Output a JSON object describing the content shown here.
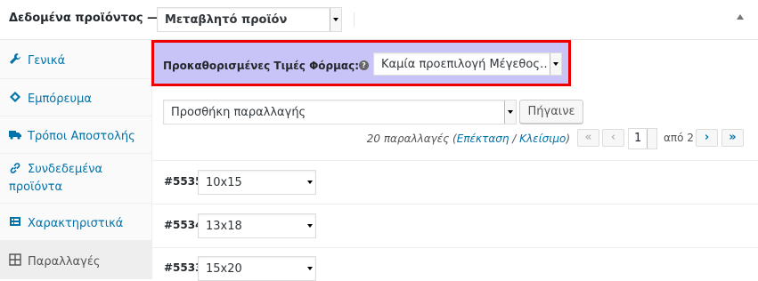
{
  "header": {
    "title": "Δεδομένα προϊόντος —",
    "product_type": "Μεταβλητό προϊόν"
  },
  "sidebar": {
    "items": [
      {
        "label": "Γενικά",
        "icon": "wrench-icon"
      },
      {
        "label": "Εμπόρευμα",
        "icon": "tag-icon"
      },
      {
        "label": "Τρόποι Αποστολής",
        "icon": "truck-icon"
      },
      {
        "label_line1": "Συνδεδεμένα",
        "label_line2": "προϊόντα",
        "icon": "link-icon"
      },
      {
        "label": "Χαρακτηριστικά",
        "icon": "list-icon"
      },
      {
        "label": "Παραλλαγές",
        "icon": "grid-icon"
      }
    ]
  },
  "defaults": {
    "label": "Προκαθορισμένες Τιμές Φόρμας:",
    "help": "?",
    "value": "Καμία προεπιλογή Μέγεθος…"
  },
  "toolbar": {
    "action": "Προσθήκη παραλλαγής",
    "go": "Πήγαινε",
    "count_prefix": "20 παραλλαγές (",
    "expand": "Επέκταση",
    "slash": " / ",
    "close": "Κλείσιμο",
    "count_suffix": ")",
    "first": "«",
    "prev": "‹",
    "page": "1",
    "of": "από 2",
    "next": "›",
    "last": "»"
  },
  "variations": [
    {
      "id": "#5535",
      "value": "10x15"
    },
    {
      "id": "#5534",
      "value": "13x18"
    },
    {
      "id": "#5533",
      "value": "15x20"
    }
  ],
  "colors": {
    "highlight": "#c9c4f7",
    "border": "#ee0000",
    "link": "#0073aa"
  }
}
